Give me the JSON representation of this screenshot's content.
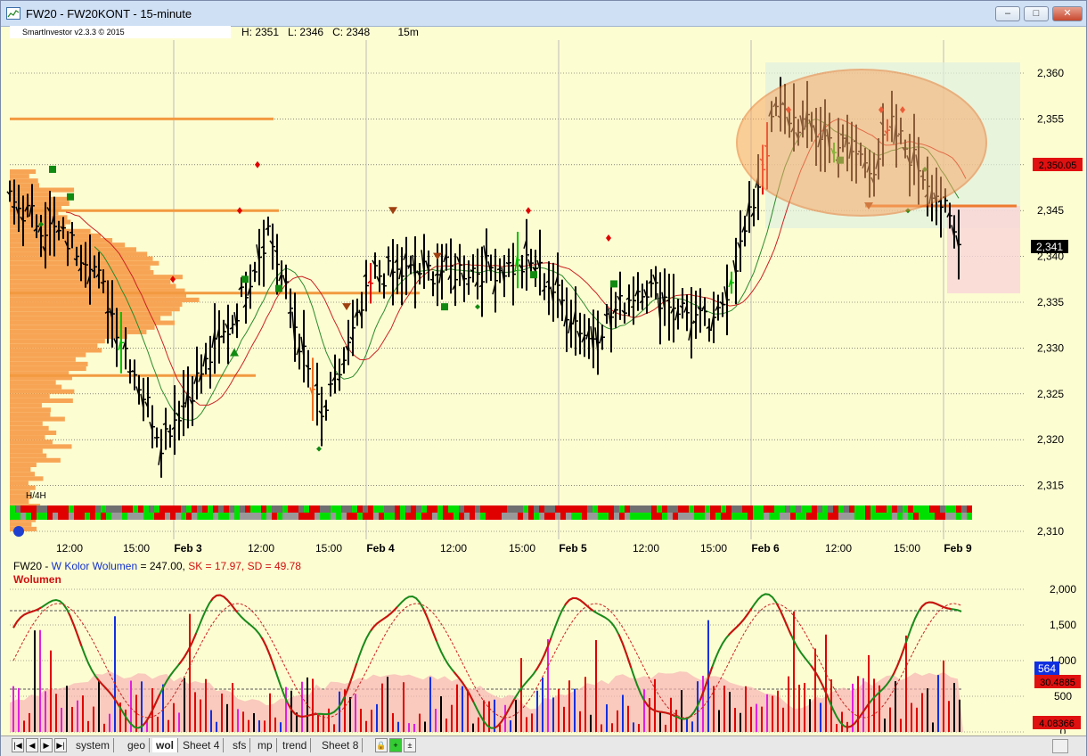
{
  "window": {
    "title": "FW20 - FW20KONT - 15-minute",
    "controls": [
      "–",
      "□",
      "✕"
    ]
  },
  "info": {
    "badge": "SmartInvestor v2.3.3 © 2015",
    "high": "H: 2351",
    "low": "L: 2346",
    "close": "C: 2348",
    "interval": "15m"
  },
  "price_axis": {
    "labels": [
      "2,360",
      "2,355",
      "2,350",
      "2,345",
      "2,340",
      "2,335",
      "2,330",
      "2,325",
      "2,320",
      "2,315",
      "2,310"
    ],
    "current_price_badge": "2,341",
    "level_badge": "2,350.05"
  },
  "time_axis": {
    "labels": [
      "12:00",
      "15:00",
      "Feb 3",
      "12:00",
      "15:00",
      "Feb 4",
      "12:00",
      "15:00",
      "Feb 5",
      "12:00",
      "15:00",
      "Feb 6",
      "12:00",
      "15:00",
      "Feb 9"
    ]
  },
  "profile_label": "H/4H",
  "volume_panel": {
    "title_prefix": "FW20 - ",
    "title_blue": "W Kolor Wolumen",
    "title_rest": " = 247.00, ",
    "sk": "SK = 17.97,",
    "sd": "SD = 49.78",
    "subtitle": "Wolumen",
    "axis_labels": [
      "2,000",
      "1,500",
      "1,000",
      "500",
      "0"
    ],
    "badge_blue": "564",
    "badge_red_1": "30.4885",
    "badge_red_2": "4.08366"
  },
  "tabs": [
    "system",
    "geo",
    "wol",
    "Sheet 4",
    "sfs",
    "mp",
    "trend",
    "Sheet 8"
  ],
  "active_tab": "wol",
  "colors": {
    "background": "#fdfdd2",
    "bull": "#00c000",
    "bear": "#e00000",
    "profile": "#f7a555",
    "ma": "#228822"
  }
}
